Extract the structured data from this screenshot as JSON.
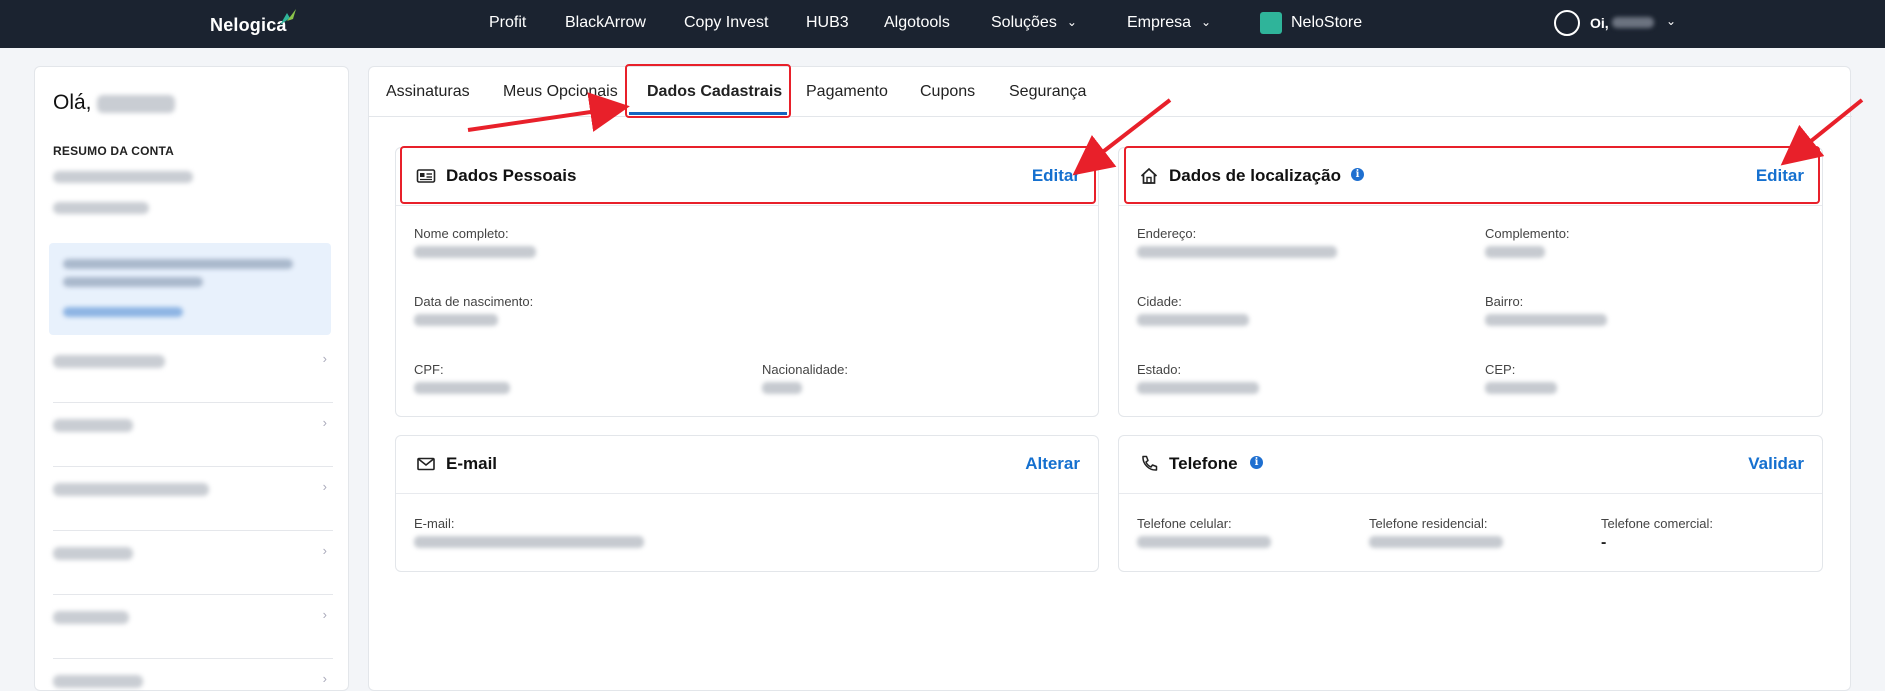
{
  "nav": {
    "logo": "Nelogica",
    "links": [
      "Profit",
      "BlackArrow",
      "Copy Invest",
      "HUB3",
      "Algotools"
    ],
    "dropdowns": [
      "Soluções",
      "Empresa"
    ],
    "store": "NeloStore",
    "user_greeting": "Oi,"
  },
  "sidebar": {
    "hello": "Olá,",
    "summary_title": "RESUMO DA CONTA"
  },
  "tabs": [
    "Assinaturas",
    "Meus Opcionais",
    "Dados Cadastrais",
    "Pagamento",
    "Cupons",
    "Segurança"
  ],
  "active_tab": "Dados Cadastrais",
  "cards": {
    "pessoais": {
      "title": "Dados Pessoais",
      "action": "Editar",
      "fields": [
        "Nome completo:",
        "Data de nascimento:",
        "CPF:",
        "Nacionalidade:"
      ]
    },
    "localizacao": {
      "title": "Dados de localização",
      "action": "Editar",
      "fields": [
        "Endereço:",
        "Complemento:",
        "Cidade:",
        "Bairro:",
        "Estado:",
        "CEP:"
      ]
    },
    "email": {
      "title": "E-mail",
      "action": "Alterar",
      "fields": [
        "E-mail:"
      ]
    },
    "telefone": {
      "title": "Telefone",
      "action": "Validar",
      "fields": [
        "Telefone celular:",
        "Telefone residencial:",
        "Telefone comercial:"
      ],
      "comercial_value": "-"
    }
  },
  "colors": {
    "topbar": "#1b2330",
    "accent": "#1570cf",
    "annotation": "#e8202a"
  }
}
